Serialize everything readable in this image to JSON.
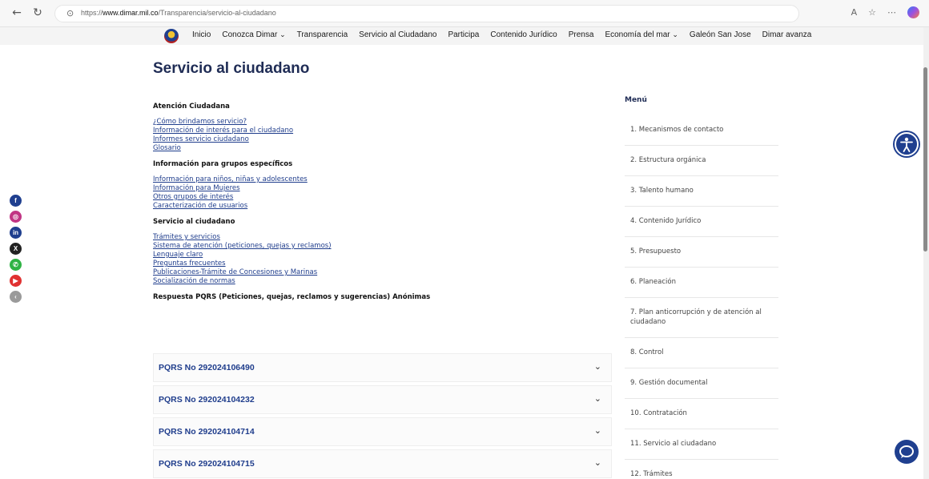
{
  "browser": {
    "url_prefix": "https://",
    "url_host": "www.dimar.mil.co",
    "url_path": "/Transparencia/servicio-al-ciudadano",
    "tools": [
      "A",
      "☆",
      "⋯"
    ]
  },
  "nav": {
    "items": [
      "Inicio",
      "Conozca Dimar",
      "Transparencia",
      "Servicio al Ciudadano",
      "Participa",
      "Contenido Jurídico",
      "Prensa",
      "Economía del mar",
      "Galeón San Jose",
      "Dimar avanza"
    ]
  },
  "page": {
    "title": "Servicio al ciudadano"
  },
  "sections": [
    {
      "heading": "Atención Ciudadana",
      "links": [
        "¿Cómo brindamos servicio?",
        "Información de interés para el ciudadano",
        "Informes servicio ciudadano",
        "Glosario"
      ]
    },
    {
      "heading": "Información para grupos específicos",
      "links": [
        "Información para niños, niñas y adolescentes",
        "Información para Mujeres",
        "Otros grupos de interés",
        "Caracterización de usuarios"
      ]
    },
    {
      "heading": "Servicio al ciudadano",
      "links": [
        "Trámites y servicios",
        "Sistema de atención (peticiones, quejas y reclamos)",
        "Lenguaje claro",
        "Preguntas frecuentes",
        "Publicaciones-Trámite de Concesiones y Marinas",
        "Socialización de normas"
      ]
    },
    {
      "heading": "Respuesta PQRS (Peticiones, quejas, reclamos y sugerencias) Anónimas",
      "links": []
    }
  ],
  "pqrs": [
    "PQRS No 292024106490",
    "PQRS No 292024104232",
    "PQRS No 292024104714",
    "PQRS No 292024104715"
  ],
  "side_menu": {
    "title": "Menú",
    "items": [
      "1. Mecanismos de contacto",
      "2. Estructura orgánica",
      "3. Talento humano",
      "4. Contenido Jurídico",
      "5. Presupuesto",
      "6. Planeación",
      "7. Plan anticorrupción y de atención al ciudadano",
      "8. Control",
      "9. Gestión documental",
      "10. Contratación",
      "11. Servicio al ciudadano",
      "12. Trámites"
    ]
  },
  "social": [
    {
      "name": "facebook",
      "glyph": "f",
      "color": "#1f3f8f"
    },
    {
      "name": "instagram",
      "glyph": "◎",
      "color": "#c13584"
    },
    {
      "name": "linkedin",
      "glyph": "in",
      "color": "#1f3f8f"
    },
    {
      "name": "x",
      "glyph": "X",
      "color": "#222222"
    },
    {
      "name": "whatsapp",
      "glyph": "✆",
      "color": "#2fb344"
    },
    {
      "name": "youtube",
      "glyph": "▶",
      "color": "#e03131"
    },
    {
      "name": "collapse",
      "glyph": "‹",
      "color": "#9a9a9a"
    }
  ]
}
